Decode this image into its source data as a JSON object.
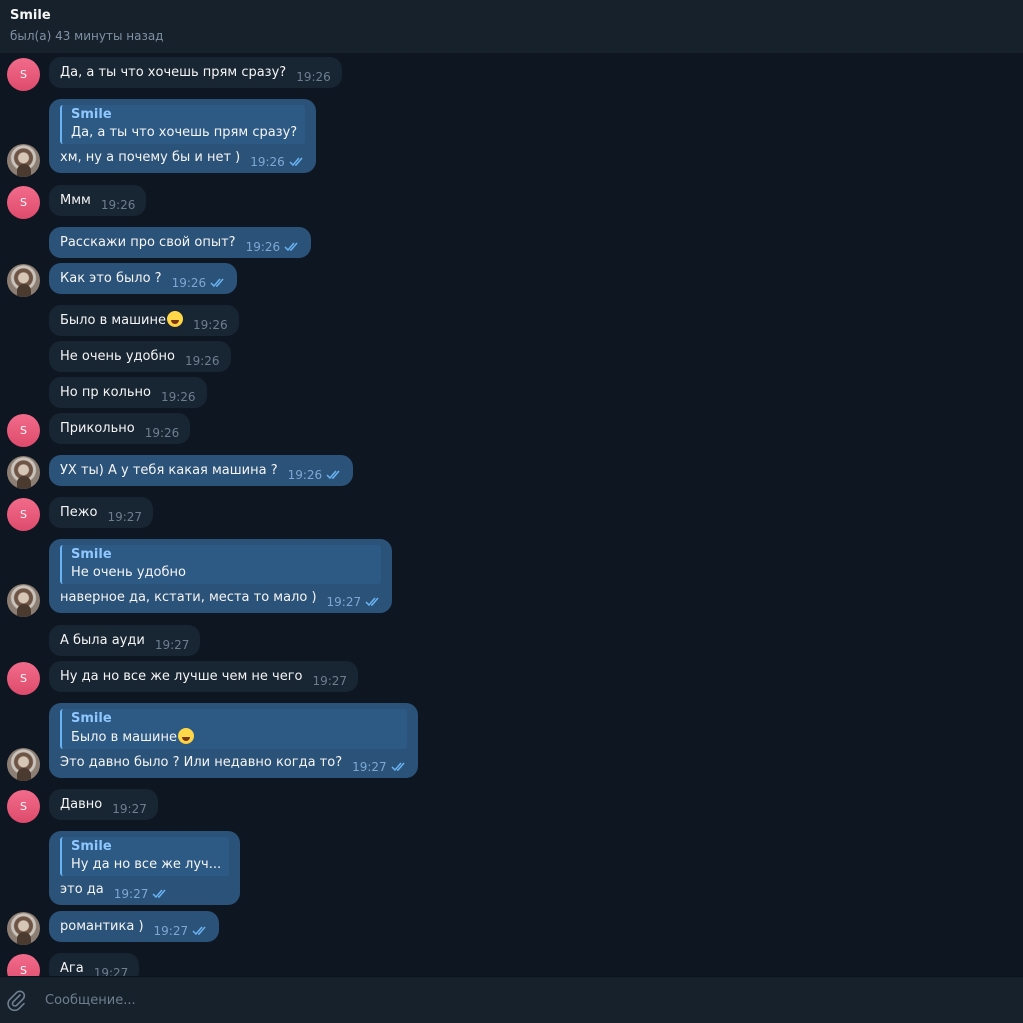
{
  "header": {
    "title": "Smile",
    "status": "был(а) 43 минуты назад"
  },
  "avatar": {
    "initial": "S"
  },
  "messages": [
    {
      "text": "Да, а ты что хочешь прям сразу?",
      "time": "19:26"
    },
    {
      "reply_name": "Smile",
      "reply_text": "Да, а ты что хочешь прям сразу?",
      "text": "хм, ну а почему бы и нет )",
      "time": "19:26"
    },
    {
      "text": "Ммм",
      "time": "19:26"
    },
    {
      "text": "Расскажи про свой опыт?",
      "time": "19:26"
    },
    {
      "text": "Как это было ?",
      "time": "19:26"
    },
    {
      "text": "Было в машине",
      "time": "19:26"
    },
    {
      "text": "Не очень удобно",
      "time": "19:26"
    },
    {
      "text": "Но пр кольно",
      "time": "19:26"
    },
    {
      "text": "Прикольно",
      "time": "19:26"
    },
    {
      "text": "УХ ты) А у тебя какая машина ?",
      "time": "19:26"
    },
    {
      "text": "Пежо",
      "time": "19:27"
    },
    {
      "reply_name": "Smile",
      "reply_text": "Не очень удобно",
      "text": "наверное да, кстати, места то мало )",
      "time": "19:27"
    },
    {
      "text": "А была ауди",
      "time": "19:27"
    },
    {
      "text": "Ну да но все же лучше чем не чего",
      "time": "19:27"
    },
    {
      "reply_name": "Smile",
      "reply_text": "Было в машине",
      "text": "Это давно было ? Или недавно когда то?",
      "time": "19:27"
    },
    {
      "text": "Давно",
      "time": "19:27"
    },
    {
      "reply_name": "Smile",
      "reply_text": "Ну да но все же луч...",
      "text": "это да",
      "time": "19:27"
    },
    {
      "text": "романтика )",
      "time": "19:27"
    },
    {
      "text": "Ага",
      "time": "19:27"
    }
  ],
  "composer": {
    "placeholder": "Сообщение..."
  },
  "icons": {
    "attach": "paperclip-icon",
    "read": "double-check-icon",
    "emoji": "laughing-emoji-icon"
  },
  "colors": {
    "background": "#0e1621",
    "incoming": "#182533",
    "outgoing": "#2b5278",
    "accent": "#6ab3f3"
  }
}
